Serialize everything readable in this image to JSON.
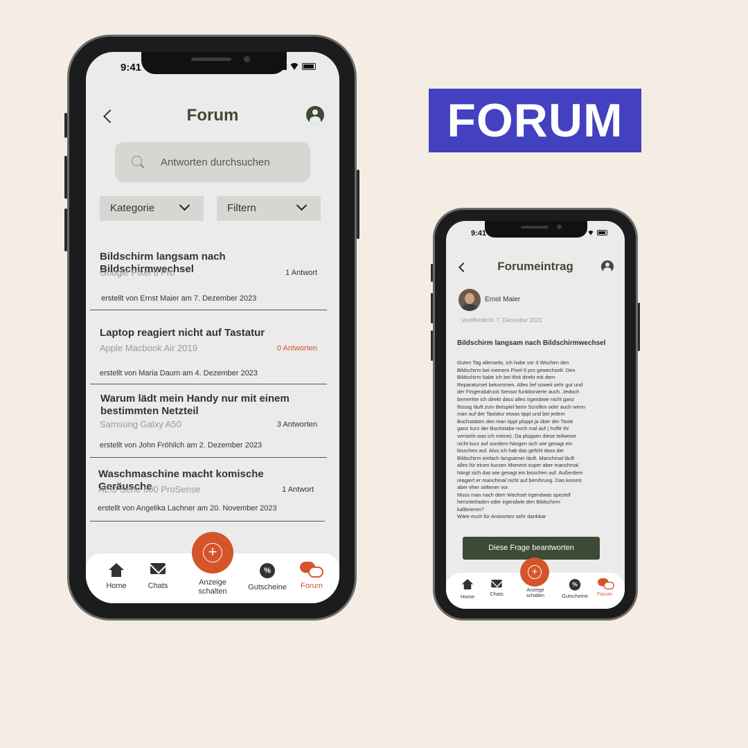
{
  "heading": "FORUM",
  "status": {
    "time": "9:41"
  },
  "forum_screen": {
    "title": "Forum",
    "search": {
      "placeholder": "Antworten durchsuchen"
    },
    "filters": {
      "category": "Kategorie",
      "filter": "Filtern"
    },
    "posts": [
      {
        "title": "Bildschirm langsam nach Bildschirmwechsel",
        "device": "Google Pixel 6 Pro",
        "answers": "1 Antwort",
        "meta": "erstellt von Ernst Maier am 7. Dezember 2023"
      },
      {
        "title": "Laptop reagiert nicht auf Tastatur",
        "device": "Apple Macbook Air 2019",
        "answers": "0 Antworten",
        "meta": "erstellt von Maria Daum  am 4. Dezember 2023"
      },
      {
        "title": "Warum lädt mein Handy nur mit einem bestimmten Netzteil",
        "device": "Samsung Galxy A50",
        "answers": "3 Antworten",
        "meta": "erstellt von John Fröhlich am 2. Dezember 2023"
      },
      {
        "title": "Waschmaschine macht komische Geräusche",
        "device": "AEG Serie 600 ProSense",
        "answers": "1 Antwort",
        "meta": "erstellt von Angelika Lachner am 20. November 2023"
      }
    ]
  },
  "nav": {
    "home": "Home",
    "chats": "Chats",
    "create_line1": "Anzeige",
    "create_line2": "schalten",
    "coupons": "Gutscheine",
    "forum": "Forum",
    "coupon_symbol": "%",
    "fab_symbol": "+"
  },
  "entry_screen": {
    "title": "Forumeintrag",
    "author": "Ernst Maier",
    "published": "Veröffentlicht: 7. Dezember 2023",
    "post_title": "Bildschirm langsam nach Bildschirmwechsel",
    "body": "Guten Tag allerseits, ich habe vor 3 Wochen den\nBildschirm bei meinem Pixel 6 pro gewechselt. Den\nBildschirm habe ich bei ifixit direkt mit dem\nReparaturset bekommen. Alles lief soweit sehr gut und\nder Fingerabdruck Sensor funktionierte auch. Jedoch\nbemerkte ich direkt dass alles irgendwie nicht ganz\nflüssig läuft zum Beispiel beim Scrollen oder auch wenn\nman auf der Tastatur etwas tippt und bei jedem\nBuchstaben den man tippt ploppt ja über der Taste\nganz kurz der Buchstabe noch mal auf ( hoffe ihr\nversteht was ich meine). Da ploppen diese teilweise\nnicht kurz auf sondern hängen sich wie gesagt ein\nbisschen auf. Also ich hab das gefühl dass der\nBildschirm einfach langsamer läuft. Manchmal läuft\nalles für einen kurzen Moment super aber manchmal\nhängt sich das wie gesagt ein bisschen auf. Außerdem\nreagiert er manchmal nicht auf berührung. Das kommt\naber eher seltener vor.\nMuss man nach dem Wechsel irgendwas speziell\nherunterladen oder irgendwie den Bildschirm\nkalibrieren?\nWäre euch für Antworten sehr dankbar",
    "answer_button": "Diese Frage beantworten"
  },
  "colors": {
    "background": "#f5ede3",
    "accent": "#d4552a",
    "dark_green": "#3d4a35",
    "badge": "#4341c0"
  },
  "icons": [
    "back-icon",
    "account-icon",
    "search-icon",
    "chevron-down-icon",
    "home-icon",
    "mail-icon",
    "add-circle-icon",
    "coupon-icon",
    "forum-chat-icon"
  ]
}
